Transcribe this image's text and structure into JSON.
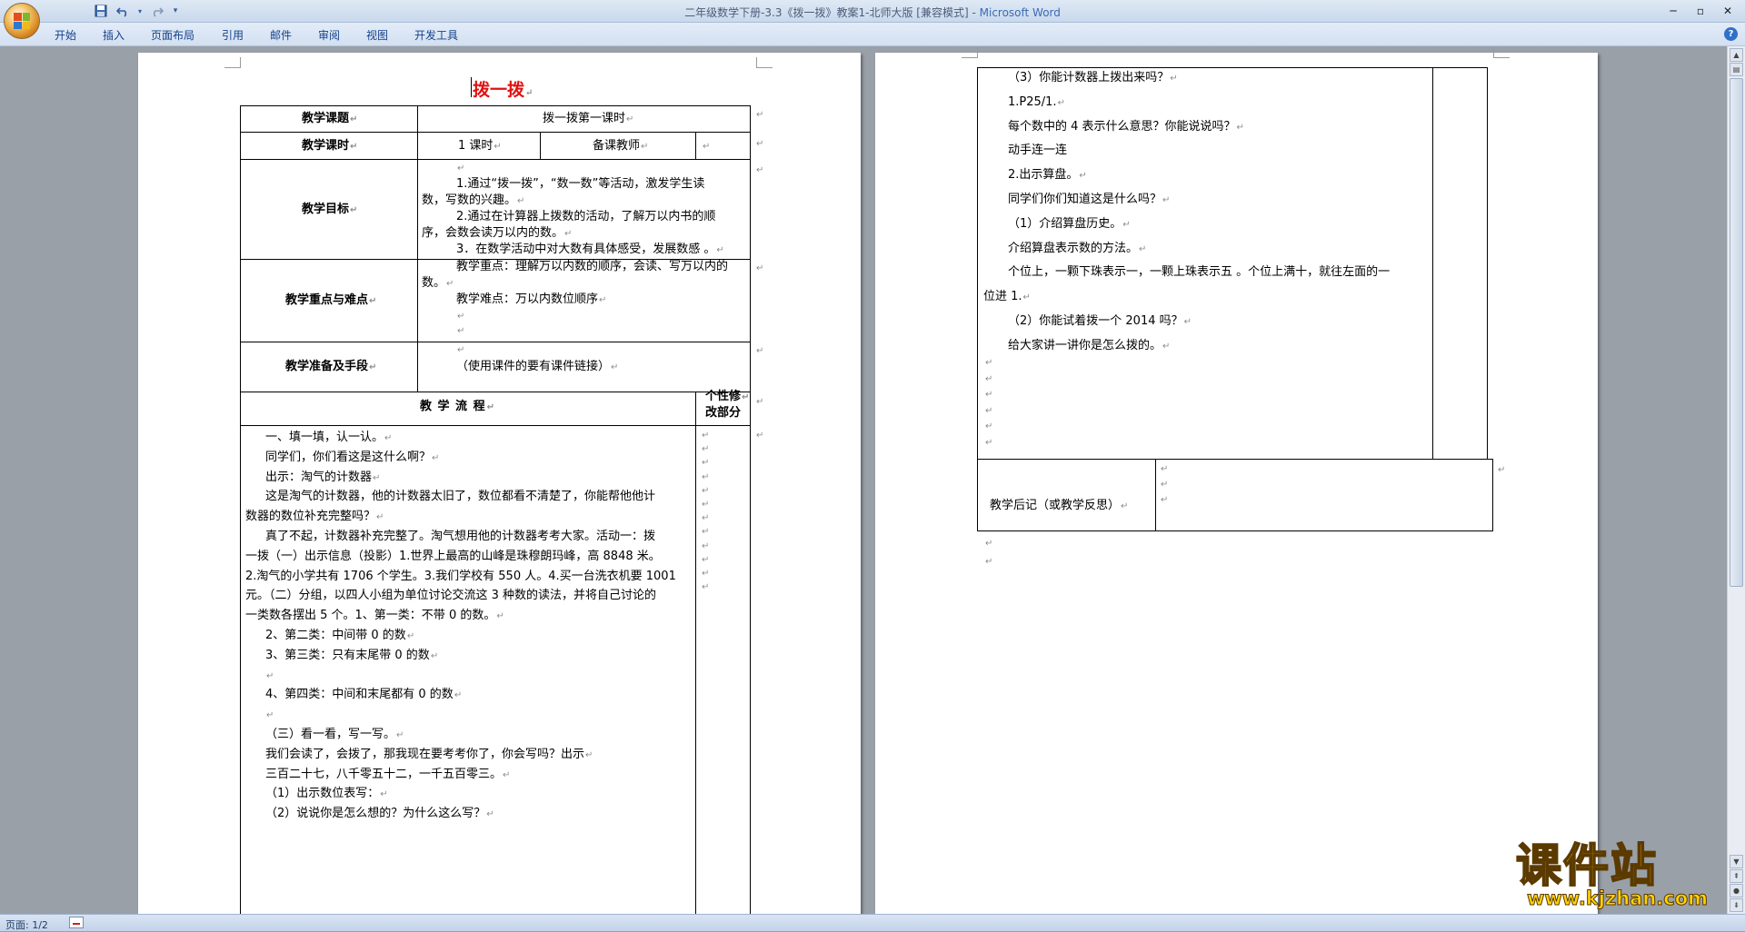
{
  "window": {
    "title_doc": "二年级数学下册-3.3《拨一拨》教案1-北师大版 [兼容模式] - ",
    "title_app": "Microsoft Word"
  },
  "ribbon": {
    "tabs": [
      "开始",
      "插入",
      "页面布局",
      "引用",
      "邮件",
      "审阅",
      "视图",
      "开发工具"
    ]
  },
  "status": {
    "page": "页面: 1/2"
  },
  "doc": {
    "title": "拨一拨",
    "rows": {
      "topic_label": "教学课题",
      "topic_value": "拨一拨第一课时",
      "hours_label": "教学课时",
      "hours_value": "1 课时",
      "teacher_label": "备课教师",
      "goals_label": "教学目标",
      "goals": [
        "1.通过“拨一拨”，“数一数”等活动，激发学生读",
        "数，写数的兴趣。",
        "2.通过在计算器上拨数的活动，了解万以内书的顺",
        "序，会数会读万以内的数。",
        "3．在数学活动中对大数有具体感受，发展数感 。"
      ],
      "focus_label": "教学重点与难点",
      "focus": [
        "教学重点：理解万以内数的顺序，会读、写万以内的",
        "数。",
        "教学难点：万以内数位顺序"
      ],
      "prep_label": "教学准备及手段",
      "prep_value": "（使用课件的要有课件链接）",
      "flow_label": "教 学 流 程",
      "personal_label_1": "个性修",
      "personal_label_2": "改部分"
    },
    "flow_lines": [
      "一、填一填，认一认。",
      "同学们，你们看这是这什么啊？",
      "出示：淘气的计数器",
      "这是淘气的计数器，他的计数器太旧了，数位都看不清楚了，你能帮他他计",
      "数器的数位补充完整吗？",
      "真了不起，计数器补充完整了。淘气想用他的计数器考考大家。活动一：拨",
      "一拨（一）出示信息（投影）1.世界上最高的山峰是珠穆朗玛峰，高 8848 米。",
      "2.淘气的小学共有 1706 个学生。3.我们学校有 550 人。4.买一台洗衣机要 1001",
      "元。（二）分组，以四人小组为单位讨论交流这 3 种数的读法，并将自己讨论的",
      "一类数各摆出 5 个。1、第一类：不带 0 的数。",
      "2、第二类：中间带 0 的数",
      "3、第三类：只有末尾带 0 的数",
      "",
      "4、第四类：中间和末尾都有 0 的数",
      "",
      "（三）看一看，写一写。",
      "我们会读了，会拨了，那我现在要考考你了，你会写吗？出示",
      "三百二十七，八千零五十二，一千五百零三。",
      "（1）出示数位表写：",
      "（2）说说你是怎么想的？为什么这么写？"
    ],
    "page2_lines": [
      "（3）你能计数器上拨出来吗？",
      "1.P25/1.",
      "每个数中的 4 表示什么意思？你能说说吗？",
      "动手连一连",
      "2.出示算盘。",
      "同学们你们知道这是什么吗？",
      "（1）介绍算盘历史。",
      "介绍算盘表示数的方法。",
      "个位上，一颗下珠表示一，一颗上珠表示五 。个位上满十，就往左面的一",
      "位进 1.",
      "（2）你能试着拨一个 2014 吗？",
      "给大家讲一讲你是怎么拨的。"
    ],
    "reflection_label": "教学后记（或教学反思）"
  },
  "watermark": {
    "big": "课件站",
    "url": "www.kjzhan.com"
  }
}
